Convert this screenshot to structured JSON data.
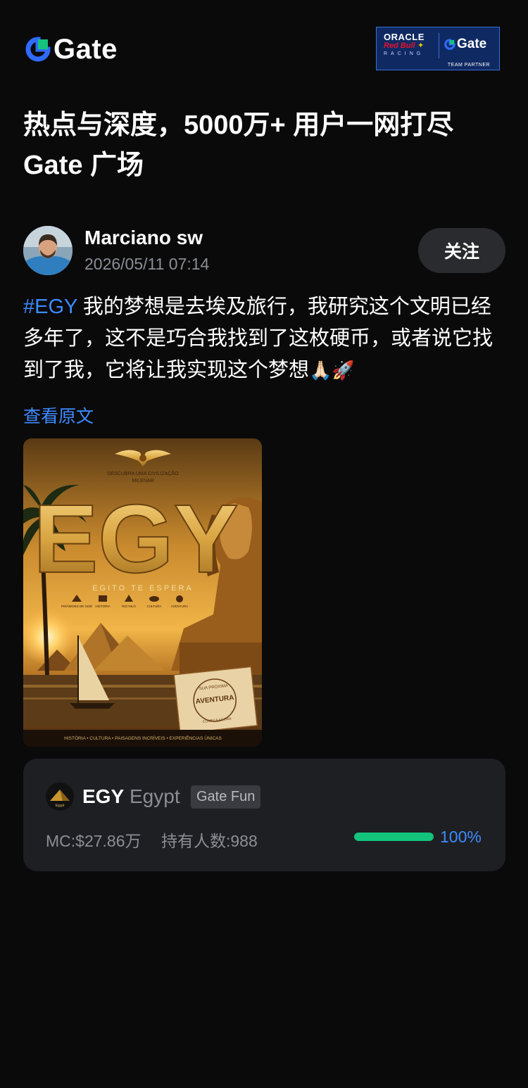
{
  "brand": {
    "logo_text": "Gate",
    "accent": "#2f6bff",
    "green": "#14c47d"
  },
  "partner": {
    "oracle": "ORACLE",
    "redbull": "Red Bull",
    "racing": "RACING",
    "gate": "Gate",
    "team_partner": "TEAM PARTNER"
  },
  "headline": {
    "line1": "热点与深度，5000万+ 用户一网打尽",
    "line2": "Gate 广场"
  },
  "post": {
    "author": "Marciano sw",
    "time": "2026/05/11 07:14",
    "follow_label": "关注",
    "hashtag": "#EGY",
    "text": " 我的梦想是去埃及旅行，我研究这个文明已经多年了，这不是巧合我找到了这枚硬币，或者说它找到了我，它将让我实现这个梦想",
    "emoji1": "🙏🏻",
    "emoji2": "🚀",
    "view_original": "查看原文"
  },
  "poster": {
    "top_line1": "DESCUBRA UMA CIVILIZAÇÃO",
    "top_line2": "MILENAR",
    "big_title": "EGY",
    "subtitle": "EGITO TE ESPERA",
    "features": [
      "PIRÂMIDES DE GIZÉ",
      "HISTÓRIA",
      "RIO NILO",
      "CULTURA",
      "AVENTURA"
    ],
    "stamp_top": "SUA PRÓXIMA",
    "stamp_main": "AVENTURA",
    "stamp_bottom": "COMEÇA AGORA",
    "footer": "HISTÓRIA • CULTURA • PAISAGENS INCRÍVEIS • EXPERIÊNCIAS ÚNICAS"
  },
  "token": {
    "logo_label": "Egypt",
    "symbol": "EGY",
    "name": "Egypt",
    "tag": "Gate Fun",
    "market_cap": "MC:$27.86万",
    "holders": "持有人数:988",
    "progress_percent": 100,
    "progress_label": "100%"
  }
}
